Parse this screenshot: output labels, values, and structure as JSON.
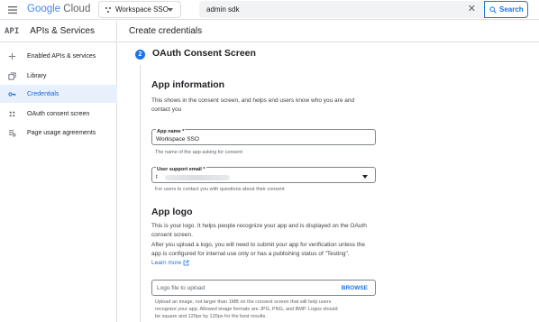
{
  "topbar": {
    "logo_google": "Google",
    "logo_cloud": "Cloud",
    "project": "Workspace SSO",
    "search_value": "admin sdk",
    "search_button": "Search"
  },
  "sidebar": {
    "badge": "API",
    "title": "APIs & Services",
    "items": [
      {
        "label": "Enabled APIs & services",
        "icon": "hub-icon"
      },
      {
        "label": "Library",
        "icon": "library-icon"
      },
      {
        "label": "Credentials",
        "icon": "key-icon"
      },
      {
        "label": "OAuth consent screen",
        "icon": "consent-icon"
      },
      {
        "label": "Page usage agreements",
        "icon": "settings-list-icon"
      }
    ],
    "active_index": 2
  },
  "main": {
    "header": "Create credentials",
    "step_number": "2",
    "step_title": "OAuth Consent Screen",
    "app_info": {
      "title": "App information",
      "description_line1": "This shows in the consent screen, and helps end users know who you are and",
      "description_line2": "contact you",
      "app_name_label": "App name *",
      "app_name_value": "Workspace SSO",
      "app_name_hint": "The name of the app asking for consent",
      "email_label": "User support email *",
      "email_value": "t",
      "email_hint": "For users to contact you with questions about their consent"
    },
    "app_logo": {
      "title": "App logo",
      "line1": "This is your logo. It helps people recognize your app and is displayed on the OAuth",
      "line2": "consent screen.",
      "line3": "After you upload a logo, you will need to submit your app for verification unless the",
      "line4": "app is configured for internal use only or has a publishing status of \"Testing\".",
      "learn_more": "Learn more",
      "upload_placeholder": "Logo file to upload",
      "browse": "BROWSE",
      "note_line1": "Upload an image, not larger than 1MB on the consent screen that will help users",
      "note_line2": "recognize your app. Allowed image formats are JPG, PNG, and BMP. Logos should",
      "note_line3": "be square and 120px by 120px for the best results."
    }
  },
  "colors": {
    "accent": "#1a73e8",
    "active_bg": "#e8f0fe"
  }
}
